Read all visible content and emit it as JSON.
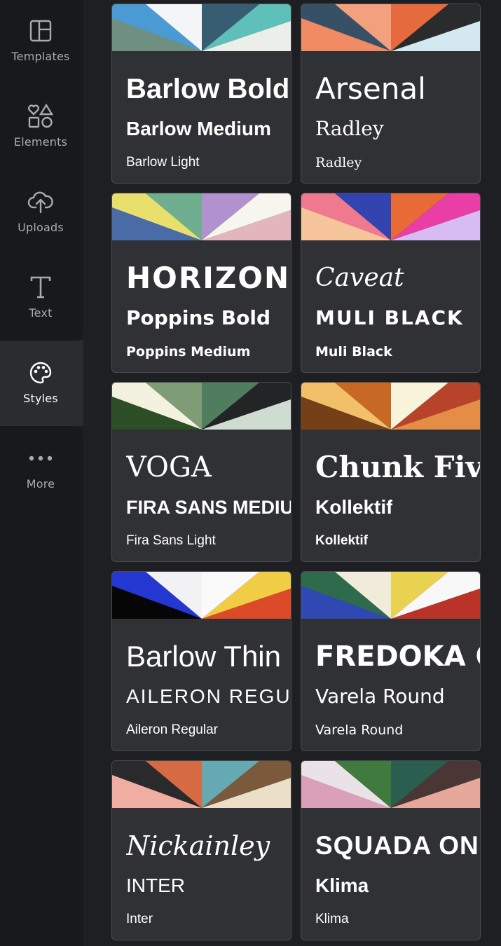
{
  "sidebar": {
    "items": [
      {
        "label": "Templates",
        "icon": "templates-icon"
      },
      {
        "label": "Elements",
        "icon": "elements-icon"
      },
      {
        "label": "Uploads",
        "icon": "upload-cloud-icon"
      },
      {
        "label": "Text",
        "icon": "text-icon"
      },
      {
        "label": "Styles",
        "icon": "palette-icon",
        "active": true
      },
      {
        "label": "More",
        "icon": "more-dots-icon"
      }
    ]
  },
  "styles": [
    {
      "heading": "Barlow Bold",
      "subheading": "Barlow Medium",
      "body": "Barlow Light",
      "colors": [
        "#4a9ad4",
        "#f4f5f6",
        "#375d73",
        "#5fbfb9",
        "#6f8f80",
        "#ecefe9"
      ]
    },
    {
      "heading": "Arsenal",
      "subheading": "Radley",
      "body": "Radley",
      "colors": [
        "#375066",
        "#f2a07d",
        "#e56a3e",
        "#2a2b2d",
        "#f08b64",
        "#d3e9ef"
      ]
    },
    {
      "heading": "HORIZON",
      "subheading": "Poppins Bold",
      "body": "Poppins Medium",
      "colors": [
        "#e8df6c",
        "#6faf8f",
        "#b291cf",
        "#f6f6ee",
        "#4b6ba6",
        "#e3b6bd"
      ]
    },
    {
      "heading": "Caveat",
      "subheading": "MULI BLACK",
      "body": "Muli Black",
      "colors": [
        "#ef7a90",
        "#3343b0",
        "#e86a36",
        "#e83ea6",
        "#f7c59b",
        "#d6bcf2"
      ]
    },
    {
      "heading": "VOGA",
      "subheading": "FIRA SANS MEDIUM",
      "body": "Fira Sans Light",
      "colors": [
        "#f3f1e0",
        "#7e9c76",
        "#4f7d5e",
        "#232426",
        "#2c4f25",
        "#cfdcd1"
      ]
    },
    {
      "heading": "Chunk Five",
      "subheading": "Kollektif",
      "body": "Kollektif",
      "colors": [
        "#f2c068",
        "#c76824",
        "#f8f4dc",
        "#b6432a",
        "#753f17",
        "#e58c47"
      ]
    },
    {
      "heading": "Barlow Thin",
      "subheading": "AILERON REGULAR",
      "body": "Aileron Regular",
      "colors": [
        "#2437d0",
        "#f2f2f4",
        "#fbfafb",
        "#f1cc45",
        "#060606",
        "#dd4a27"
      ]
    },
    {
      "heading": "FREDOKA ONE",
      "subheading": "Varela Round",
      "body": "Varela Round",
      "colors": [
        "#2f6a4c",
        "#f1ebdb",
        "#e8d24f",
        "#f8f8f8",
        "#2f48b2",
        "#ba3328"
      ]
    },
    {
      "heading": "Nickainley",
      "subheading": "INTER",
      "body": "Inter",
      "colors": [
        "#2a2a2c",
        "#d66a43",
        "#65aab3",
        "#7a5a3a",
        "#f0aea2",
        "#ecdfc8"
      ]
    },
    {
      "heading": "SQUADA ONE",
      "subheading": "Klima",
      "body": "Klima",
      "colors": [
        "#e9e2e7",
        "#417a3e",
        "#2a5e4f",
        "#4b3636",
        "#dba0b9",
        "#e5a89a"
      ]
    }
  ]
}
